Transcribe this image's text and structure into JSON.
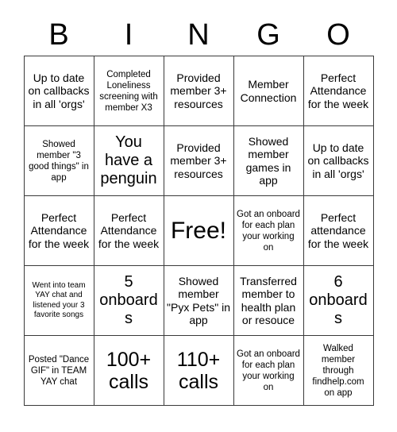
{
  "card": {
    "title": "BINGO",
    "header_letters": [
      "B",
      "I",
      "N",
      "G",
      "O"
    ],
    "free_space_label": "Free!",
    "border_color": "#3a3a3a",
    "background_color": "#ffffff",
    "text_color": "#000000",
    "rows": 5,
    "columns": 5,
    "cells": [
      [
        {
          "text": "Up to date on callbacks in all 'orgs'",
          "size": "md"
        },
        {
          "text": "Completed Loneliness screening with member X3",
          "size": "sm"
        },
        {
          "text": "Provided member 3+ resources",
          "size": "md"
        },
        {
          "text": "Member Connection",
          "size": "md"
        },
        {
          "text": "Perfect Attendance for the week",
          "size": "md"
        }
      ],
      [
        {
          "text": "Showed member \"3 good things\" in app",
          "size": "sm"
        },
        {
          "text": "You have a penguin",
          "size": "lg"
        },
        {
          "text": "Provided member 3+ resources",
          "size": "md"
        },
        {
          "text": "Showed member games in app",
          "size": "md"
        },
        {
          "text": "Up to date on callbacks in all 'orgs'",
          "size": "md"
        }
      ],
      [
        {
          "text": "Perfect Attendance for the week",
          "size": "md"
        },
        {
          "text": "Perfect Attendance for the week",
          "size": "md"
        },
        {
          "text": "Free!",
          "size": "free"
        },
        {
          "text": "Got an onboard for each plan your working on",
          "size": "sm"
        },
        {
          "text": "Perfect attendance for the week",
          "size": "md"
        }
      ],
      [
        {
          "text": "Went into team YAY chat and listened your 3 favorite songs",
          "size": "xs"
        },
        {
          "text": "5 onboards",
          "size": "lg"
        },
        {
          "text": "Showed member \"Pyx Pets\" in app",
          "size": "md"
        },
        {
          "text": "Transferred member to health plan or resouce",
          "size": "md"
        },
        {
          "text": "6 onboards",
          "size": "lg"
        }
      ],
      [
        {
          "text": "Posted \"Dance GIF\" in TEAM YAY chat",
          "size": "sm"
        },
        {
          "text": "100+ calls",
          "size": "xl"
        },
        {
          "text": "110+ calls",
          "size": "xl"
        },
        {
          "text": "Got an onboard for each plan your working on",
          "size": "sm"
        },
        {
          "text": "Walked member through findhelp.com on app",
          "size": "sm"
        }
      ]
    ]
  }
}
